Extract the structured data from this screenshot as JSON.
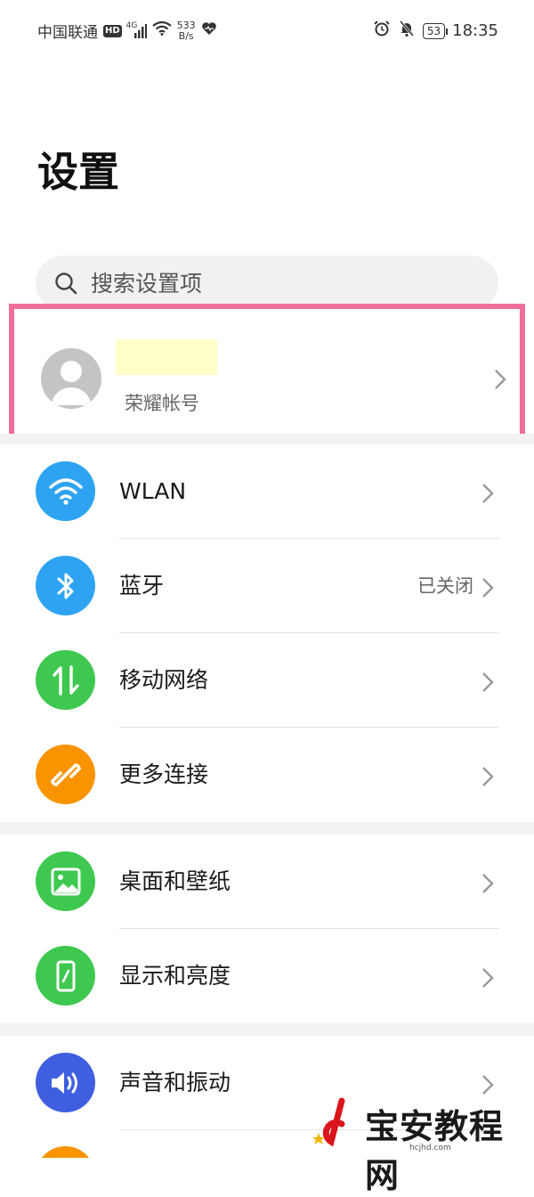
{
  "status_bar": {
    "carrier": "中国联通",
    "hd": "HD",
    "network_type": "4G",
    "speed_value": "533",
    "speed_unit": "B/s",
    "battery": "53",
    "time": "18:35"
  },
  "page_title": "设置",
  "search": {
    "placeholder": "搜索设置项"
  },
  "account": {
    "label": "荣耀帐号"
  },
  "groups": [
    {
      "items": [
        {
          "label": "WLAN",
          "icon": "wifi-icon",
          "color": "#2ea3f2",
          "status": ""
        },
        {
          "label": "蓝牙",
          "icon": "bluetooth-icon",
          "color": "#2ea3f2",
          "status": "已关闭"
        },
        {
          "label": "移动网络",
          "icon": "mobile-data-icon",
          "color": "#3ec84f",
          "status": ""
        },
        {
          "label": "更多连接",
          "icon": "link-icon",
          "color": "#f99400",
          "status": ""
        }
      ]
    },
    {
      "items": [
        {
          "label": "桌面和壁纸",
          "icon": "wallpaper-icon",
          "color": "#3ec84f",
          "status": ""
        },
        {
          "label": "显示和亮度",
          "icon": "display-icon",
          "color": "#3ec84f",
          "status": ""
        }
      ]
    },
    {
      "items": [
        {
          "label": "声音和振动",
          "icon": "sound-icon",
          "color": "#3f5fe0",
          "status": ""
        }
      ]
    }
  ],
  "watermark": {
    "text": "宝安教程网",
    "sub": "hcjhd.com"
  }
}
